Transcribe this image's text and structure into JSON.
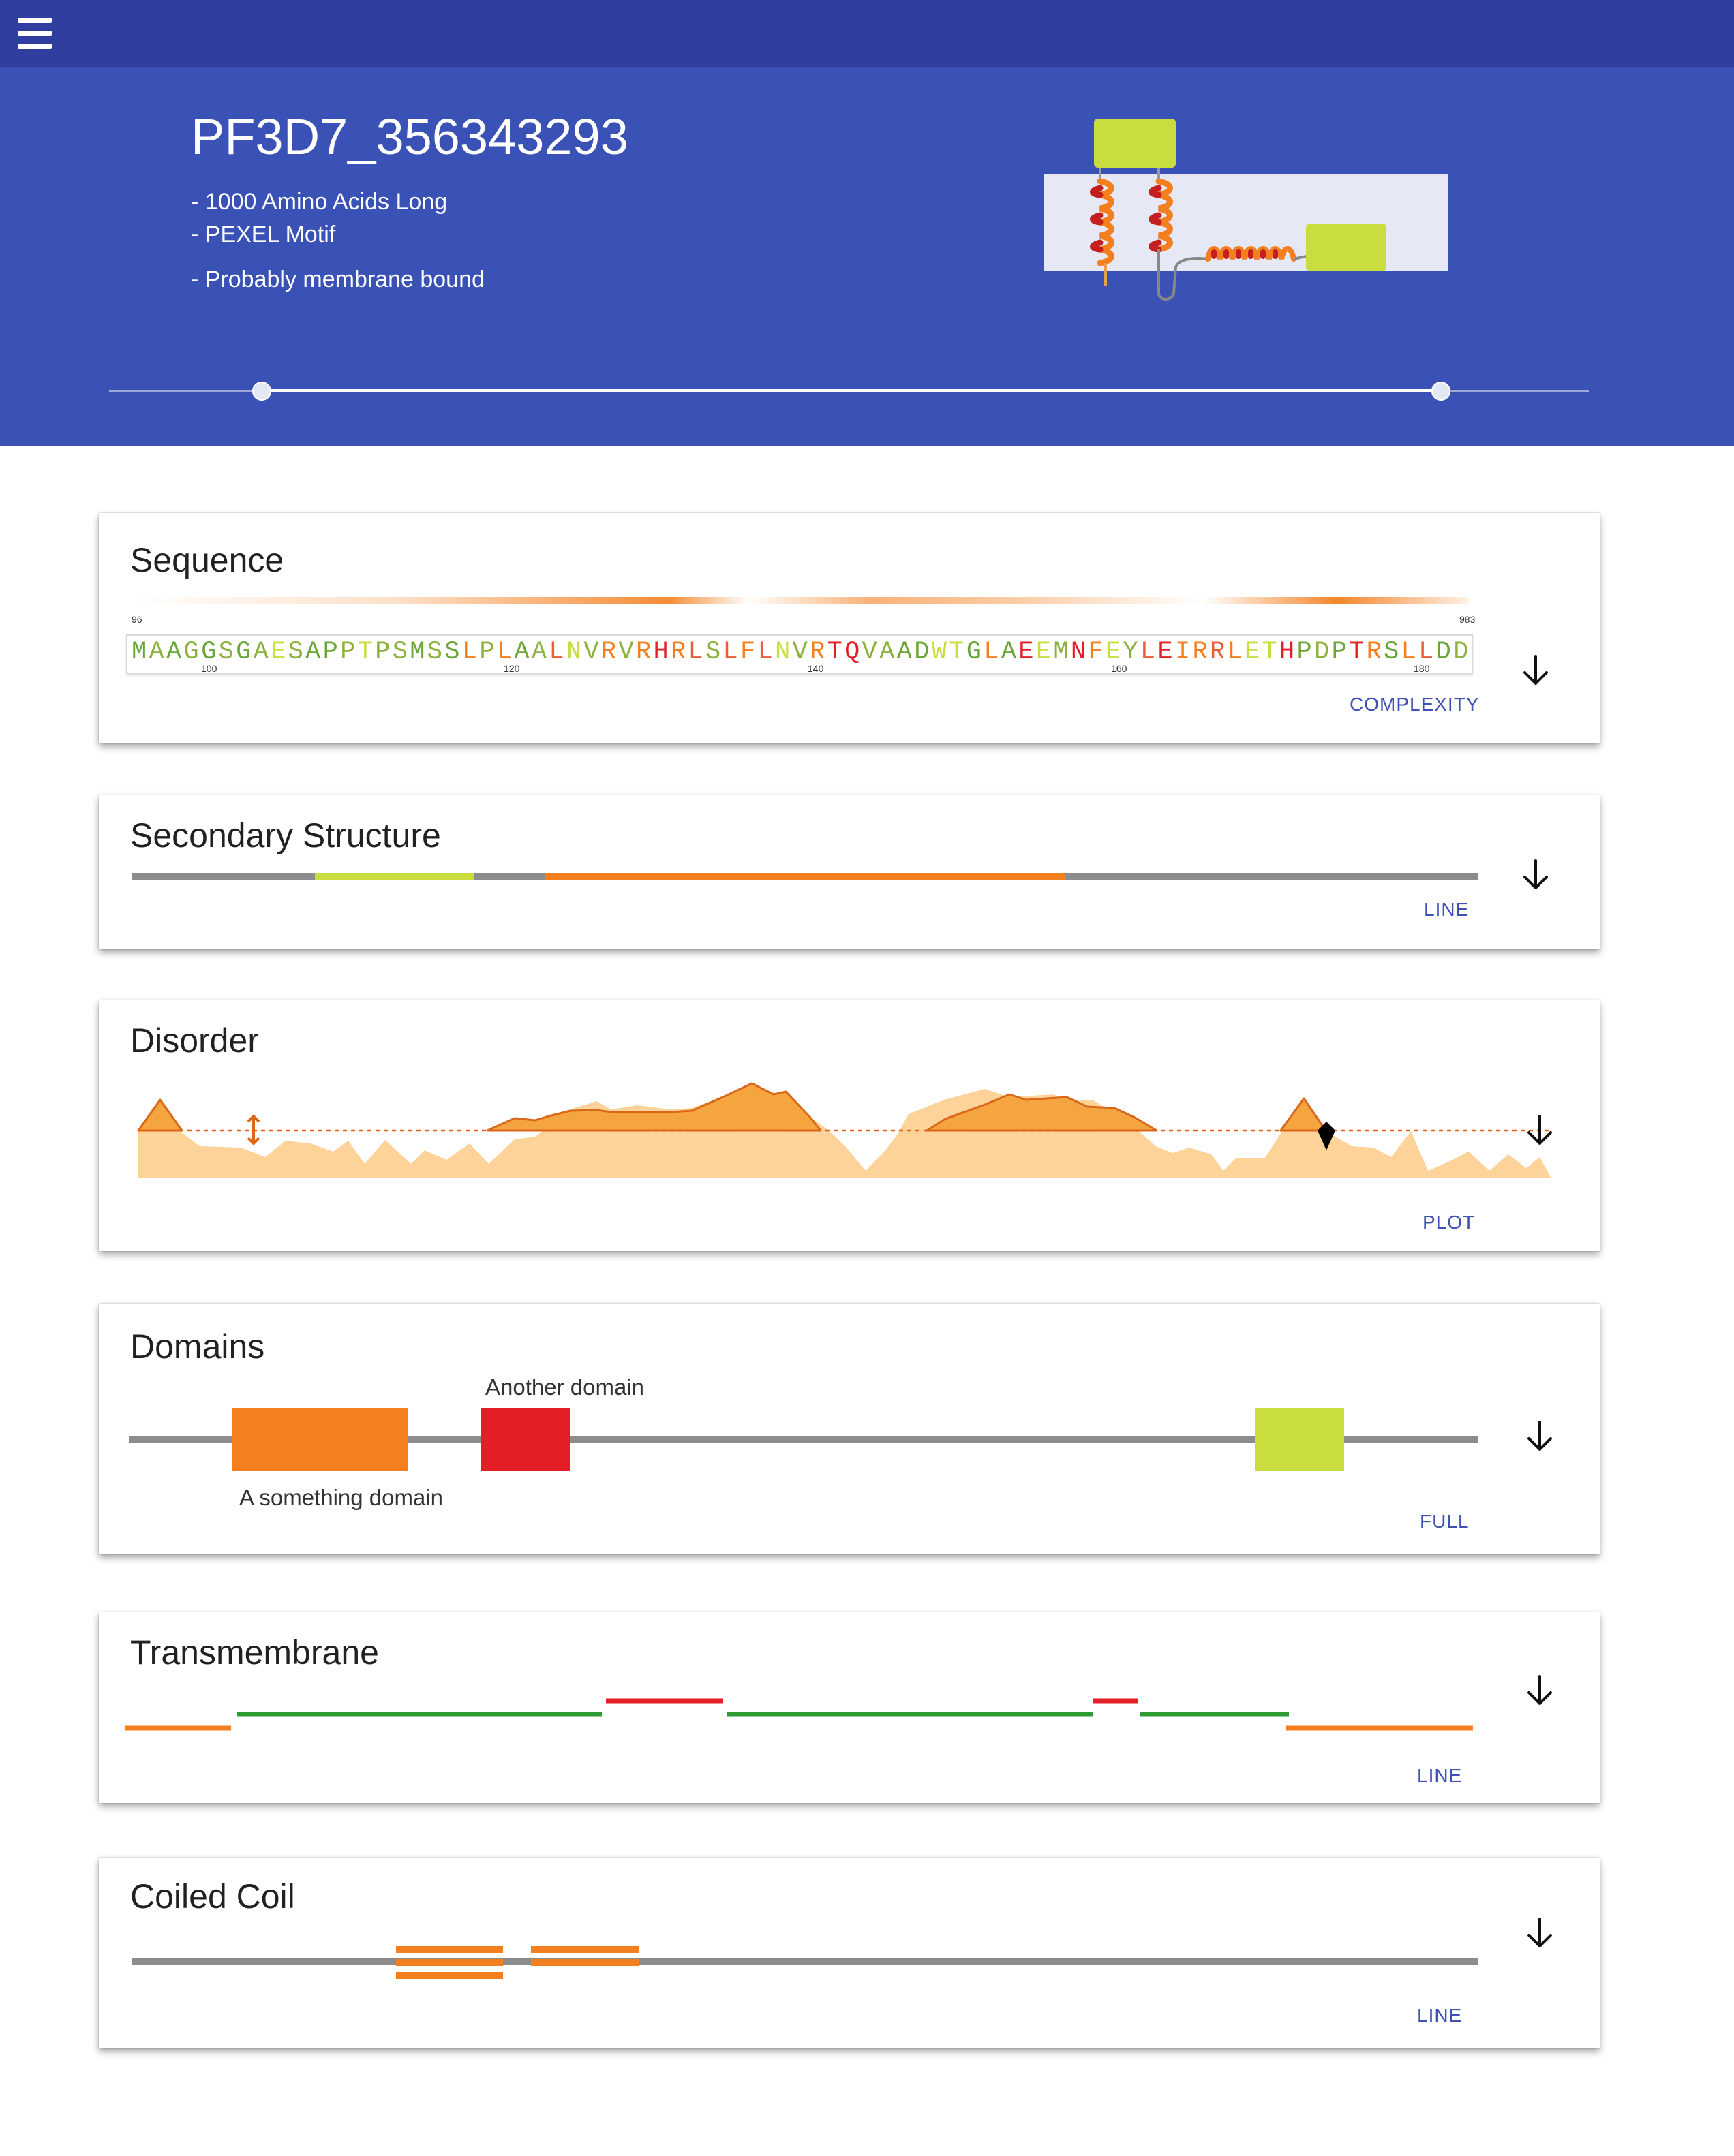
{
  "header": {
    "menu_icon": "hamburger-menu-icon"
  },
  "protein": {
    "id": "PF3D7_356343293",
    "properties": [
      "- 1000 Amino Acids Long",
      "- PEXEL Motif",
      "- Probably membrane bound"
    ]
  },
  "range_slider": {
    "min": 1,
    "max": 1000
  },
  "colors": {
    "header": "#303f9f",
    "hero": "#3a52b5",
    "orange": "#f47f1f",
    "lime": "#cadd3f",
    "red": "#e31e26",
    "green": "#2e9b35",
    "grey": "#8c8c8c",
    "mode": "#3f51b5"
  },
  "sequence": {
    "title": "Sequence",
    "start_label": "96",
    "end_label": "983",
    "residues": "MAAGGSGAESAPPTPSMSSLPLAALNVRVRHRLSLFLNVRTQVAADWTGLAEEMNFEYLEIRRLETHPDPTRSLLDD",
    "tick_labels": [
      "100",
      "120",
      "140",
      "160",
      "180"
    ],
    "mode": "COMPLEXITY"
  },
  "secondary_structure": {
    "title": "Secondary Structure",
    "mode": "LINE"
  },
  "disorder": {
    "title": "Disorder",
    "mode": "PLOT"
  },
  "domains": {
    "title": "Domains",
    "mode": "FULL",
    "items": [
      {
        "label": "A something domain",
        "color": "#f47f1f"
      },
      {
        "label": "Another domain",
        "color": "#e31e26"
      },
      {
        "label": "",
        "color": "#cadd3f"
      }
    ]
  },
  "transmembrane": {
    "title": "Transmembrane",
    "mode": "LINE"
  },
  "coiled_coil": {
    "title": "Coiled Coil",
    "mode": "LINE"
  }
}
